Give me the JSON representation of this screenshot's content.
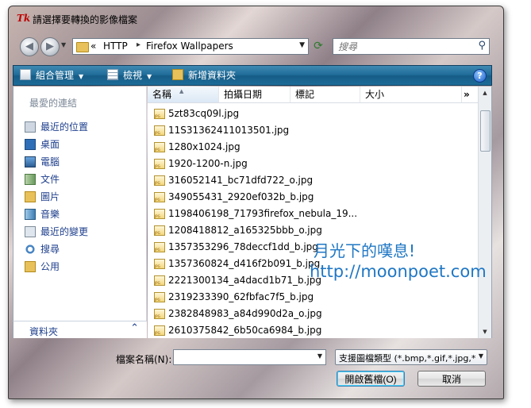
{
  "window": {
    "title": "請選擇要轉換的影像檔案",
    "app_icon_text": "Tk"
  },
  "address": {
    "crumbs": [
      "«",
      "HTTP",
      "Firefox Wallpapers"
    ]
  },
  "search": {
    "placeholder": "搜尋"
  },
  "toolbar": {
    "organize": "組合管理",
    "views": "檢視",
    "new_folder": "新增資料夾",
    "help": "?"
  },
  "sidebar": {
    "heading": "最愛的連結",
    "items": [
      {
        "label": "最近的位置",
        "icon": "recent-places-icon"
      },
      {
        "label": "桌面",
        "icon": "desktop-icon"
      },
      {
        "label": "電腦",
        "icon": "computer-icon"
      },
      {
        "label": "文件",
        "icon": "documents-icon"
      },
      {
        "label": "圖片",
        "icon": "pictures-icon"
      },
      {
        "label": "音樂",
        "icon": "music-icon"
      },
      {
        "label": "最近的變更",
        "icon": "recently-changed-icon"
      },
      {
        "label": "搜尋",
        "icon": "searches-icon"
      },
      {
        "label": "公用",
        "icon": "public-icon"
      }
    ],
    "folders_label": "資料夾"
  },
  "filelist": {
    "columns": [
      "名稱",
      "拍攝日期",
      "標記",
      "大小"
    ],
    "more": "»",
    "files": [
      "5zt83cq09l.jpg",
      "11S31362411013501.jpg",
      "1280x1024.jpg",
      "1920-1200-n.jpg",
      "316052141_bc71dfd722_o.jpg",
      "349055431_2920ef032b_b.jpg",
      "1198406198_71793firefox_nebula_19...",
      "1208418812_a165325bbb_o.jpg",
      "1357353296_78deccf1dd_b.jpg",
      "1357360824_d416f2b091_b.jpg",
      "2221300134_a4dacd1b71_b.jpg",
      "2319233390_62fbfac7f5_b.jpg",
      "2382848983_a84d990d2a_o.jpg",
      "2610375842_6b50ca6984_b.jpg"
    ]
  },
  "watermark": {
    "line1": "月光下的嘆息!",
    "line2": "http://moonpoet.com"
  },
  "footer": {
    "filename_label": "檔案名稱(N):",
    "filename_value": "",
    "filetype_value": "支援圖檔類型 (*.bmp,*.gif,*.jpg,*",
    "open_button": "開啟舊檔(O)",
    "cancel_button": "取消"
  },
  "colors": {
    "toolbar_blue": "#1f6b98",
    "link_blue": "#1e3f8c",
    "watermark_blue": "#1f77c4"
  }
}
